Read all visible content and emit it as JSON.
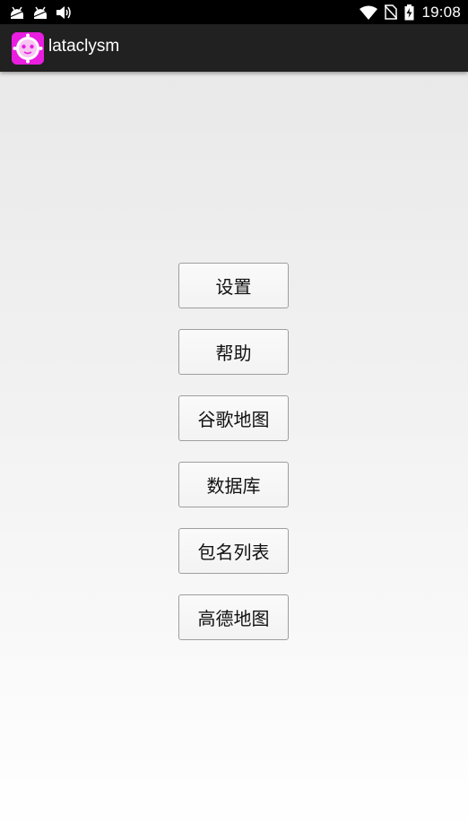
{
  "status_bar": {
    "time": "19:08",
    "left_icons": [
      "android-debug-icon",
      "android-debug-icon",
      "volume-icon"
    ],
    "right_icons": [
      "wifi-icon",
      "no-sim-icon",
      "battery-charging-icon"
    ]
  },
  "app_bar": {
    "title": "lataclysm",
    "logo_color": "#e91ee0",
    "background": "#212121"
  },
  "menu": {
    "buttons": [
      {
        "label": "设置"
      },
      {
        "label": "帮助"
      },
      {
        "label": "谷歌地图"
      },
      {
        "label": "数据库"
      },
      {
        "label": "包名列表"
      },
      {
        "label": "高德地图"
      }
    ]
  }
}
